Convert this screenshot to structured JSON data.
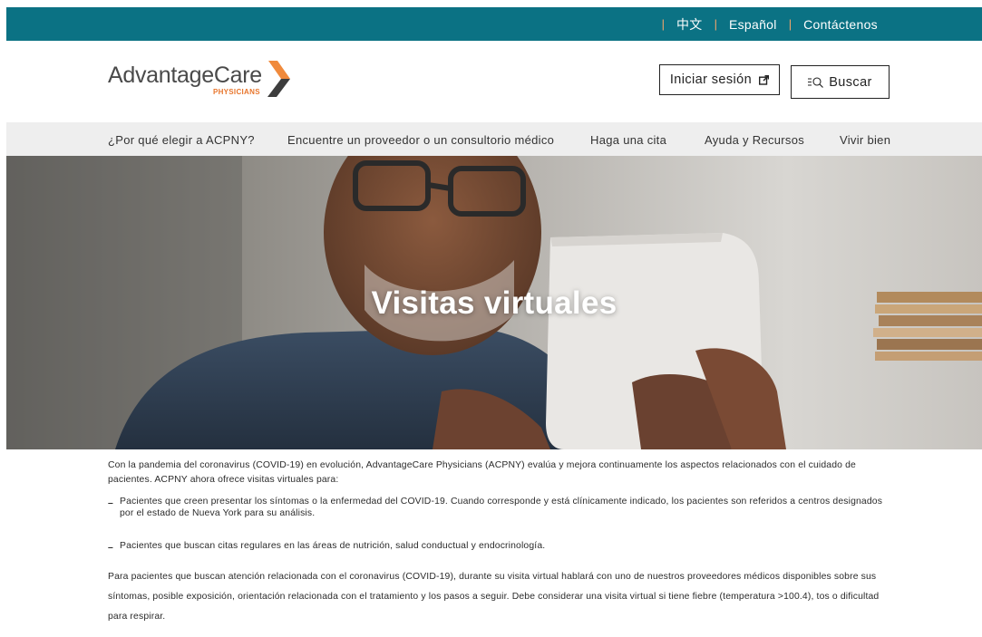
{
  "topbar": {
    "links": [
      {
        "label": "中文"
      },
      {
        "label": "Español"
      },
      {
        "label": "Contáctenos"
      }
    ],
    "background": "#0b7284",
    "separator_color": "#f4a56a"
  },
  "header": {
    "logo_main": "AdvantageCare",
    "logo_sub": "PHYSICIANS",
    "signin_label": "Iniciar sesión",
    "search_label": "Buscar",
    "brand_orange": "#e8762d"
  },
  "nav": {
    "items": [
      {
        "label": "¿Por qué elegir a ACPNY?"
      },
      {
        "label": "Encuentre un proveedor o un consultorio médico"
      },
      {
        "label": "Haga una cita"
      },
      {
        "label": "Ayuda y Recursos"
      },
      {
        "label": "Vivir bien"
      }
    ]
  },
  "hero": {
    "title": "Visitas virtuales"
  },
  "content": {
    "intro": "Con la pandemia del coronavirus (COVID-19) en evolución, AdvantageCare Physicians (ACPNY) evalúa y mejora continuamente los aspectos relacionados con el cuidado de pacientes. ACPNY ahora ofrece visitas virtuales para:",
    "bullets": [
      {
        "text": "Pacientes que creen presentar los síntomas o la enfermedad del COVID-19. Cuando corresponde y está clínicamente indicado, los pacientes son referidos a centros designados por el estado de Nueva York para su análisis."
      },
      {
        "text": "Pacientes que buscan citas regulares en las áreas de nutrición, salud conductual y endocrinología."
      }
    ],
    "paragraph": "Para pacientes que buscan atención relacionada con el coronavirus (COVID-19), durante su visita virtual hablará con uno de nuestros proveedores médicos disponibles sobre sus síntomas, posible exposición, orientación relacionada con el tratamiento y los pasos a seguir. Debe considerar una visita virtual si tiene fiebre (temperatura >100.4), tos o dificultad para respirar."
  }
}
